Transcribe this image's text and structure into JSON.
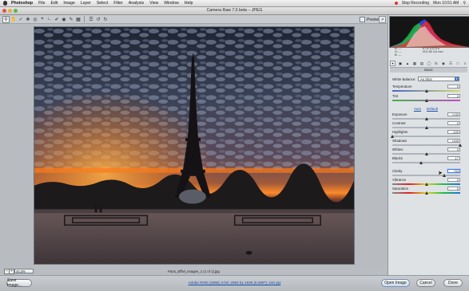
{
  "menubar": {
    "app_name": "Photoshop",
    "menus": [
      "File",
      "Edit",
      "Image",
      "Layer",
      "Select",
      "Filter",
      "Analysis",
      "View",
      "Window",
      "Help"
    ],
    "recording_label": "Stop Recording",
    "clock": "Mon 10:51 AM"
  },
  "window": {
    "title": "Camera Raw 7.0 beta  –  JPEG"
  },
  "toolbar": {
    "preview_label": "Preview",
    "preview_checked": true,
    "tools": [
      "zoom-icon",
      "hand-icon",
      "white-balance-icon",
      "color-sampler-icon",
      "target-adjust-icon",
      "crop-icon",
      "straighten-icon",
      "spot-removal-icon",
      "red-eye-icon",
      "adjustment-brush-icon",
      "graduated-filter-icon",
      "preferences-icon",
      "rotate-ccw-icon",
      "rotate-cw-icon"
    ]
  },
  "histogram": {
    "rgb_readout": [
      "R: ---",
      "G: ---",
      "B: ---"
    ],
    "exif_line1": "f/7.8    1/270 s",
    "exif_line2": "ISO 80    3.6 mm"
  },
  "panel": {
    "section_title": "Basic",
    "white_balance_label": "White Balance:",
    "white_balance_value": "As Shot",
    "auto_label": "Auto",
    "default_label": "Default",
    "sliders": [
      {
        "label": "Temperature",
        "value": "0",
        "pos": 0.5
      },
      {
        "label": "Tint",
        "value": "0",
        "pos": 0.5
      },
      {
        "label": "Exposure",
        "value": "0.00",
        "pos": 0.5
      },
      {
        "label": "Contrast",
        "value": "0",
        "pos": 0.5
      },
      {
        "label": "Highlights",
        "value": "-100",
        "pos": 0.0
      },
      {
        "label": "Shadows",
        "value": "+100",
        "pos": 1.0
      },
      {
        "label": "Whites",
        "value": "0",
        "pos": 0.5
      },
      {
        "label": "Blacks",
        "value": "-17",
        "pos": 0.42
      },
      {
        "label": "Clarity",
        "value": "+53",
        "pos": 0.76
      },
      {
        "label": "Vibrance",
        "value": "0",
        "pos": 0.5
      },
      {
        "label": "Saturation",
        "value": "0",
        "pos": 0.5
      }
    ]
  },
  "status": {
    "zoom": "44.3%",
    "filename": "Paris_Effiel_Images_1 (1 of 1).jpg"
  },
  "bottom": {
    "save_label": "Save Image...",
    "workflow_link": "Adobe RGB (1998); 8 bit; 2592 by 1936 (5.0MP); 240 ppi",
    "open_label": "Open Image",
    "cancel_label": "Cancel",
    "done_label": "Done"
  },
  "colors": {
    "accent": "#3e78c5",
    "link": "#1a4fa7",
    "sky_dark": "#1b2434",
    "sunset": "#ff7a18"
  }
}
